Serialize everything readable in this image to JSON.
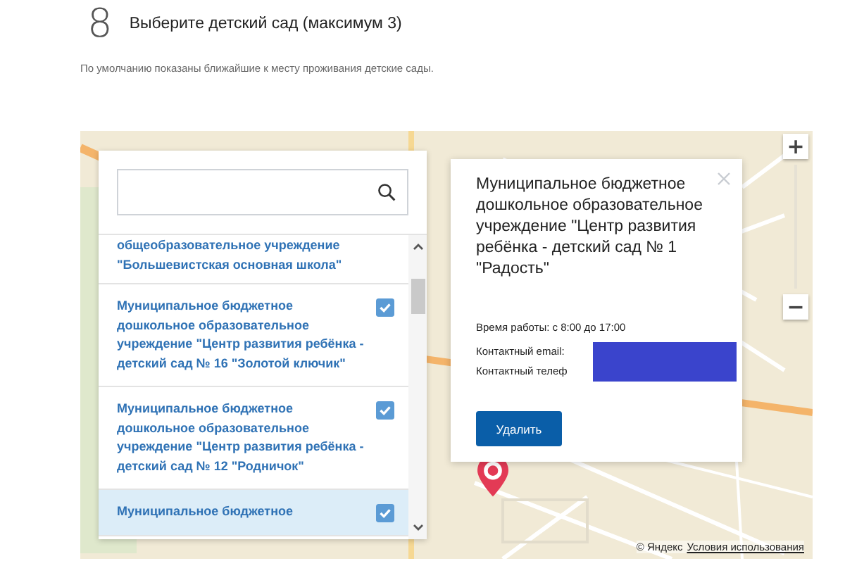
{
  "step": {
    "number": "8",
    "title": "Выберите детский сад (максимум 3)",
    "hint": "По умолчанию показаны ближайшие к месту проживания детские сады."
  },
  "list": {
    "items": [
      {
        "text": "общеобразовательное учреждение \"Большевистская основная школа\"",
        "checked": false,
        "selected": false
      },
      {
        "text": "Муниципальное бюджетное дошкольное образовательное учреждение \"Центр развития ребёнка - детский сад № 16 \"Золотой ключик\"",
        "checked": true,
        "selected": false
      },
      {
        "text": "Муниципальное бюджетное дошкольное образовательное учреждение \"Центр развития ребёнка - детский сад № 12 \"Родничок\"",
        "checked": true,
        "selected": false
      },
      {
        "text": "Муниципальное бюджетное",
        "checked": true,
        "selected": true
      }
    ]
  },
  "popup": {
    "title": "Муниципальное бюджетное дошкольное образовательное учреждение \"Центр развития ребёнка - детский сад № 1 \"Радость\"",
    "hours": "Время работы: с 8:00 до 17:00",
    "email_label": "Контактный email:",
    "phone_label": "Контактный телеф",
    "button": "Удалить"
  },
  "map": {
    "zoom_in": "+",
    "zoom_out": "−",
    "copyright": "© Яндекс",
    "terms_link": "Условия использования"
  }
}
